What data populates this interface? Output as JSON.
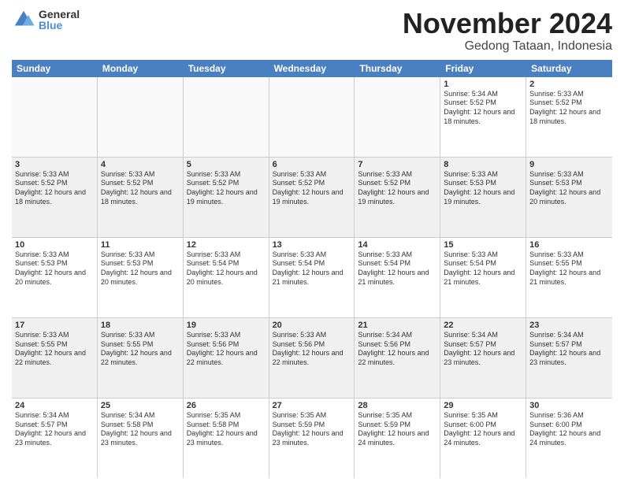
{
  "logo": {
    "general": "General",
    "blue": "Blue"
  },
  "header": {
    "month": "November 2024",
    "location": "Gedong Tataan, Indonesia"
  },
  "weekdays": [
    "Sunday",
    "Monday",
    "Tuesday",
    "Wednesday",
    "Thursday",
    "Friday",
    "Saturday"
  ],
  "weeks": [
    [
      {
        "day": "",
        "empty": true
      },
      {
        "day": "",
        "empty": true
      },
      {
        "day": "",
        "empty": true
      },
      {
        "day": "",
        "empty": true
      },
      {
        "day": "",
        "empty": true
      },
      {
        "day": "1",
        "rise": "5:34 AM",
        "set": "5:52 PM",
        "daylight": "12 hours and 18 minutes."
      },
      {
        "day": "2",
        "rise": "5:33 AM",
        "set": "5:52 PM",
        "daylight": "12 hours and 18 minutes."
      }
    ],
    [
      {
        "day": "3",
        "rise": "5:33 AM",
        "set": "5:52 PM",
        "daylight": "12 hours and 18 minutes."
      },
      {
        "day": "4",
        "rise": "5:33 AM",
        "set": "5:52 PM",
        "daylight": "12 hours and 18 minutes."
      },
      {
        "day": "5",
        "rise": "5:33 AM",
        "set": "5:52 PM",
        "daylight": "12 hours and 19 minutes."
      },
      {
        "day": "6",
        "rise": "5:33 AM",
        "set": "5:52 PM",
        "daylight": "12 hours and 19 minutes."
      },
      {
        "day": "7",
        "rise": "5:33 AM",
        "set": "5:52 PM",
        "daylight": "12 hours and 19 minutes."
      },
      {
        "day": "8",
        "rise": "5:33 AM",
        "set": "5:53 PM",
        "daylight": "12 hours and 19 minutes."
      },
      {
        "day": "9",
        "rise": "5:33 AM",
        "set": "5:53 PM",
        "daylight": "12 hours and 20 minutes."
      }
    ],
    [
      {
        "day": "10",
        "rise": "5:33 AM",
        "set": "5:53 PM",
        "daylight": "12 hours and 20 minutes."
      },
      {
        "day": "11",
        "rise": "5:33 AM",
        "set": "5:53 PM",
        "daylight": "12 hours and 20 minutes."
      },
      {
        "day": "12",
        "rise": "5:33 AM",
        "set": "5:54 PM",
        "daylight": "12 hours and 20 minutes."
      },
      {
        "day": "13",
        "rise": "5:33 AM",
        "set": "5:54 PM",
        "daylight": "12 hours and 21 minutes."
      },
      {
        "day": "14",
        "rise": "5:33 AM",
        "set": "5:54 PM",
        "daylight": "12 hours and 21 minutes."
      },
      {
        "day": "15",
        "rise": "5:33 AM",
        "set": "5:54 PM",
        "daylight": "12 hours and 21 minutes."
      },
      {
        "day": "16",
        "rise": "5:33 AM",
        "set": "5:55 PM",
        "daylight": "12 hours and 21 minutes."
      }
    ],
    [
      {
        "day": "17",
        "rise": "5:33 AM",
        "set": "5:55 PM",
        "daylight": "12 hours and 22 minutes."
      },
      {
        "day": "18",
        "rise": "5:33 AM",
        "set": "5:55 PM",
        "daylight": "12 hours and 22 minutes."
      },
      {
        "day": "19",
        "rise": "5:33 AM",
        "set": "5:56 PM",
        "daylight": "12 hours and 22 minutes."
      },
      {
        "day": "20",
        "rise": "5:33 AM",
        "set": "5:56 PM",
        "daylight": "12 hours and 22 minutes."
      },
      {
        "day": "21",
        "rise": "5:34 AM",
        "set": "5:56 PM",
        "daylight": "12 hours and 22 minutes."
      },
      {
        "day": "22",
        "rise": "5:34 AM",
        "set": "5:57 PM",
        "daylight": "12 hours and 23 minutes."
      },
      {
        "day": "23",
        "rise": "5:34 AM",
        "set": "5:57 PM",
        "daylight": "12 hours and 23 minutes."
      }
    ],
    [
      {
        "day": "24",
        "rise": "5:34 AM",
        "set": "5:57 PM",
        "daylight": "12 hours and 23 minutes."
      },
      {
        "day": "25",
        "rise": "5:34 AM",
        "set": "5:58 PM",
        "daylight": "12 hours and 23 minutes."
      },
      {
        "day": "26",
        "rise": "5:35 AM",
        "set": "5:58 PM",
        "daylight": "12 hours and 23 minutes."
      },
      {
        "day": "27",
        "rise": "5:35 AM",
        "set": "5:59 PM",
        "daylight": "12 hours and 23 minutes."
      },
      {
        "day": "28",
        "rise": "5:35 AM",
        "set": "5:59 PM",
        "daylight": "12 hours and 24 minutes."
      },
      {
        "day": "29",
        "rise": "5:35 AM",
        "set": "6:00 PM",
        "daylight": "12 hours and 24 minutes."
      },
      {
        "day": "30",
        "rise": "5:36 AM",
        "set": "6:00 PM",
        "daylight": "12 hours and 24 minutes."
      }
    ]
  ]
}
